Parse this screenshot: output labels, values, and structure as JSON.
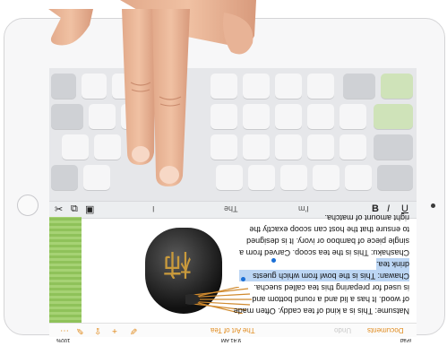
{
  "document": {
    "lines": [
      "right amount of matcha.",
      "to ensure that the host can scoop exactly the",
      "single piece of bamboo or ivory. It is designed",
      "Chashaku: This is the tea scoop. Carved from a",
      "drink tea.",
      "Chawan: This is the bowl from which guests",
      "is used for preparing this tea called suecha.",
      "of wood. It has a lid and a round bottom and",
      "Natsume: This is a kind of tea caddy. Often made"
    ],
    "highlighted_line_indices": [
      4,
      5
    ],
    "pot_character": "柿"
  },
  "shortcut_bar": {
    "cut_icon": "✂",
    "copy_icon": "⧉",
    "paste_icon": "▣",
    "suggestions": [
      "I",
      "The",
      "I'm"
    ],
    "bold": "B",
    "italic": "I",
    "underline": "U"
  },
  "toolbar": {
    "documents_label": "Documents",
    "undo_label": "Undo",
    "title": "The Art of Tea",
    "icons": [
      "brush-icon",
      "add-icon",
      "share-icon",
      "wrench-icon",
      "more-icon"
    ]
  },
  "status_bar": {
    "carrier": "iPad",
    "time": "9:41 AM",
    "battery": "100%"
  },
  "colors": {
    "accent": "#e08a1c",
    "selection": "#bcd6f4",
    "handle": "#1b6fd6"
  }
}
